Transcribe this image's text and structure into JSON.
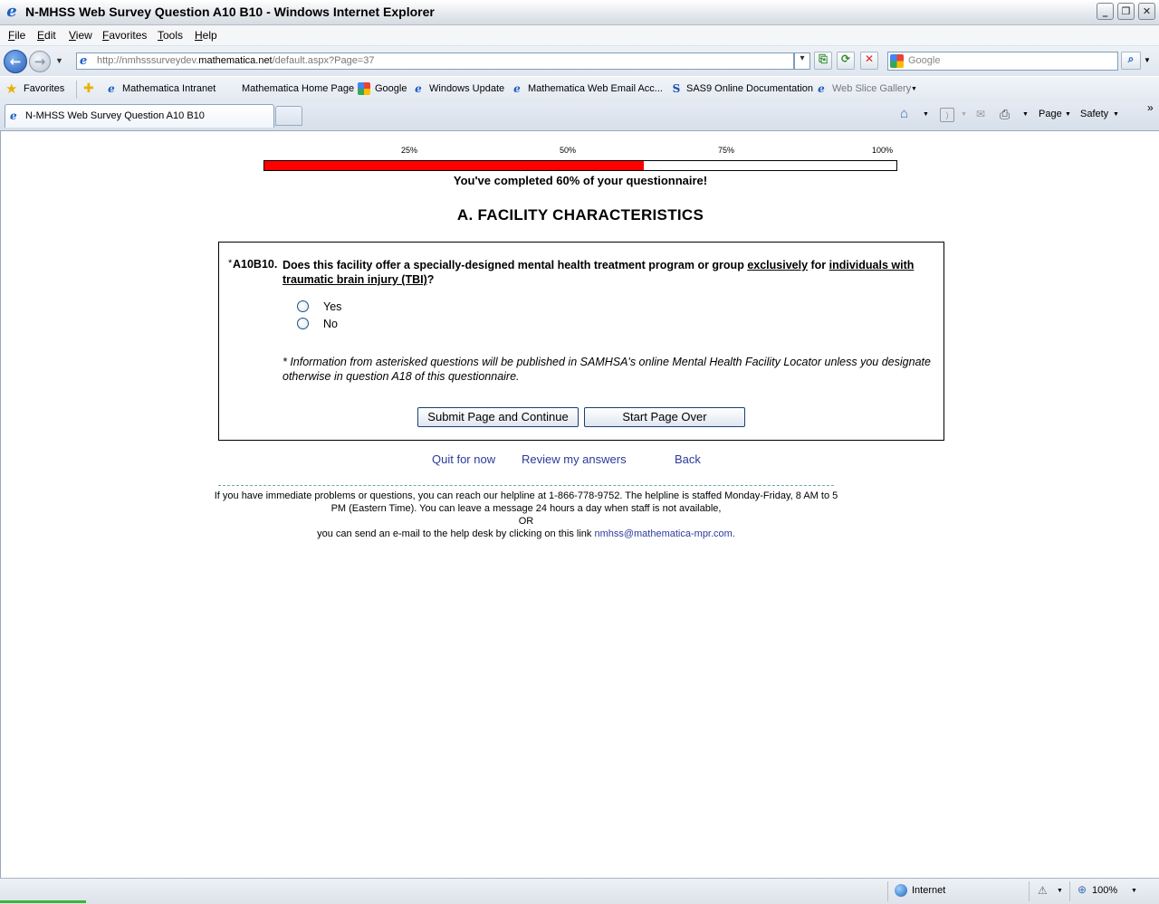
{
  "window": {
    "title": "N-MHSS Web Survey Question A10 B10 - Windows Internet Explorer",
    "minimize_glyph": "_",
    "restore_glyph": "❐",
    "close_glyph": "✕"
  },
  "menu": [
    "File",
    "Edit",
    "View",
    "Favorites",
    "Tools",
    "Help"
  ],
  "address": {
    "url_prefix": "http://nmhsssurveydev.",
    "url_domain": "mathematica.net",
    "url_suffix": "/default.aspx?Page=37"
  },
  "search": {
    "placeholder": "Google"
  },
  "favorites": {
    "label": "Favorites",
    "items": [
      "Mathematica Intranet",
      "Mathematica Home Page",
      "Google",
      "Windows Update",
      "Mathematica Web Email Acc...",
      "SAS9 Online Documentation",
      "Web Slice Gallery"
    ]
  },
  "tab": {
    "label": "N-MHSS Web Survey Question A10 B10"
  },
  "command_bar": {
    "page": "Page",
    "safety": "Safety"
  },
  "progress": {
    "ticks": [
      "25%",
      "50%",
      "75%",
      "100%"
    ],
    "percent": 60,
    "text": "You've completed 60% of your questionnaire!"
  },
  "section_title": "A. FACILITY CHARACTERISTICS",
  "question": {
    "star": "*",
    "id": "A10B10.",
    "text_part1": "Does this facility offer a specially-designed mental health treatment program or group ",
    "text_u1": "exclusively",
    "text_part2": " for ",
    "text_u2": "individuals with traumatic brain injury (TBI)",
    "text_part3": "?",
    "options": [
      "Yes",
      "No"
    ],
    "footnote": "* Information from asterisked questions will be published in SAMHSA's online Mental Health Facility Locator unless you designate otherwise in question A18 of this questionnaire."
  },
  "buttons": {
    "submit": "Submit Page and Continue",
    "start_over": "Start Page Over"
  },
  "links": {
    "quit": "Quit for now",
    "review": "Review my answers",
    "back": "Back"
  },
  "help": {
    "line1": "If you have immediate problems or questions, you can reach our helpline at 1-866-778-9752. The helpline is staffed Monday-Friday, 8 AM to 5 PM (Eastern Time). You can leave a message 24 hours a day when staff is not available,",
    "or": "OR",
    "line2": "you can send an e-mail to the help desk by clicking on this link ",
    "email": "nmhss@mathematica-mpr.com."
  },
  "status": {
    "zone": "Internet",
    "zoom": "100%"
  }
}
